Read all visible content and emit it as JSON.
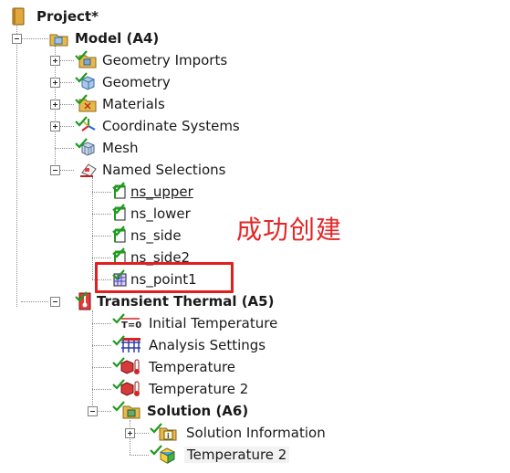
{
  "tree": {
    "project": {
      "label": "Project*",
      "icon": "project-book-icon"
    },
    "model": {
      "label": "Model (A4)",
      "icon": "model-icon",
      "children": [
        {
          "label": "Geometry Imports",
          "icon": "geometry-imports-icon"
        },
        {
          "label": "Geometry",
          "icon": "geometry-icon"
        },
        {
          "label": "Materials",
          "icon": "materials-icon"
        },
        {
          "label": "Coordinate Systems",
          "icon": "coordinate-systems-icon"
        },
        {
          "label": "Mesh",
          "icon": "mesh-icon"
        },
        {
          "label": "Named Selections",
          "icon": "named-selections-icon"
        }
      ]
    },
    "named_selections": [
      {
        "label": "ns_upper",
        "icon": "face-selection-icon"
      },
      {
        "label": "ns_lower",
        "icon": "face-selection-icon"
      },
      {
        "label": "ns_side",
        "icon": "face-selection-icon"
      },
      {
        "label": "ns_side2",
        "icon": "face-selection-icon"
      },
      {
        "label": "ns_point1",
        "icon": "node-selection-icon"
      }
    ],
    "transient": {
      "label": "Transient Thermal (A5)",
      "icon": "transient-thermal-icon",
      "children": [
        {
          "label": "Initial Temperature",
          "icon": "initial-temperature-icon"
        },
        {
          "label": "Analysis Settings",
          "icon": "analysis-settings-icon"
        },
        {
          "label": "Temperature",
          "icon": "temperature-load-icon"
        },
        {
          "label": "Temperature 2",
          "icon": "temperature-load-icon"
        }
      ]
    },
    "solution": {
      "label": "Solution (A6)",
      "icon": "solution-icon",
      "children": [
        {
          "label": "Solution Information",
          "icon": "solution-information-icon"
        },
        {
          "label": "Temperature 2",
          "icon": "temperature-result-icon"
        }
      ]
    }
  },
  "annotation": "成功创建",
  "colors": {
    "highlight": "#e31e1e",
    "check": "#1f9a1f"
  }
}
